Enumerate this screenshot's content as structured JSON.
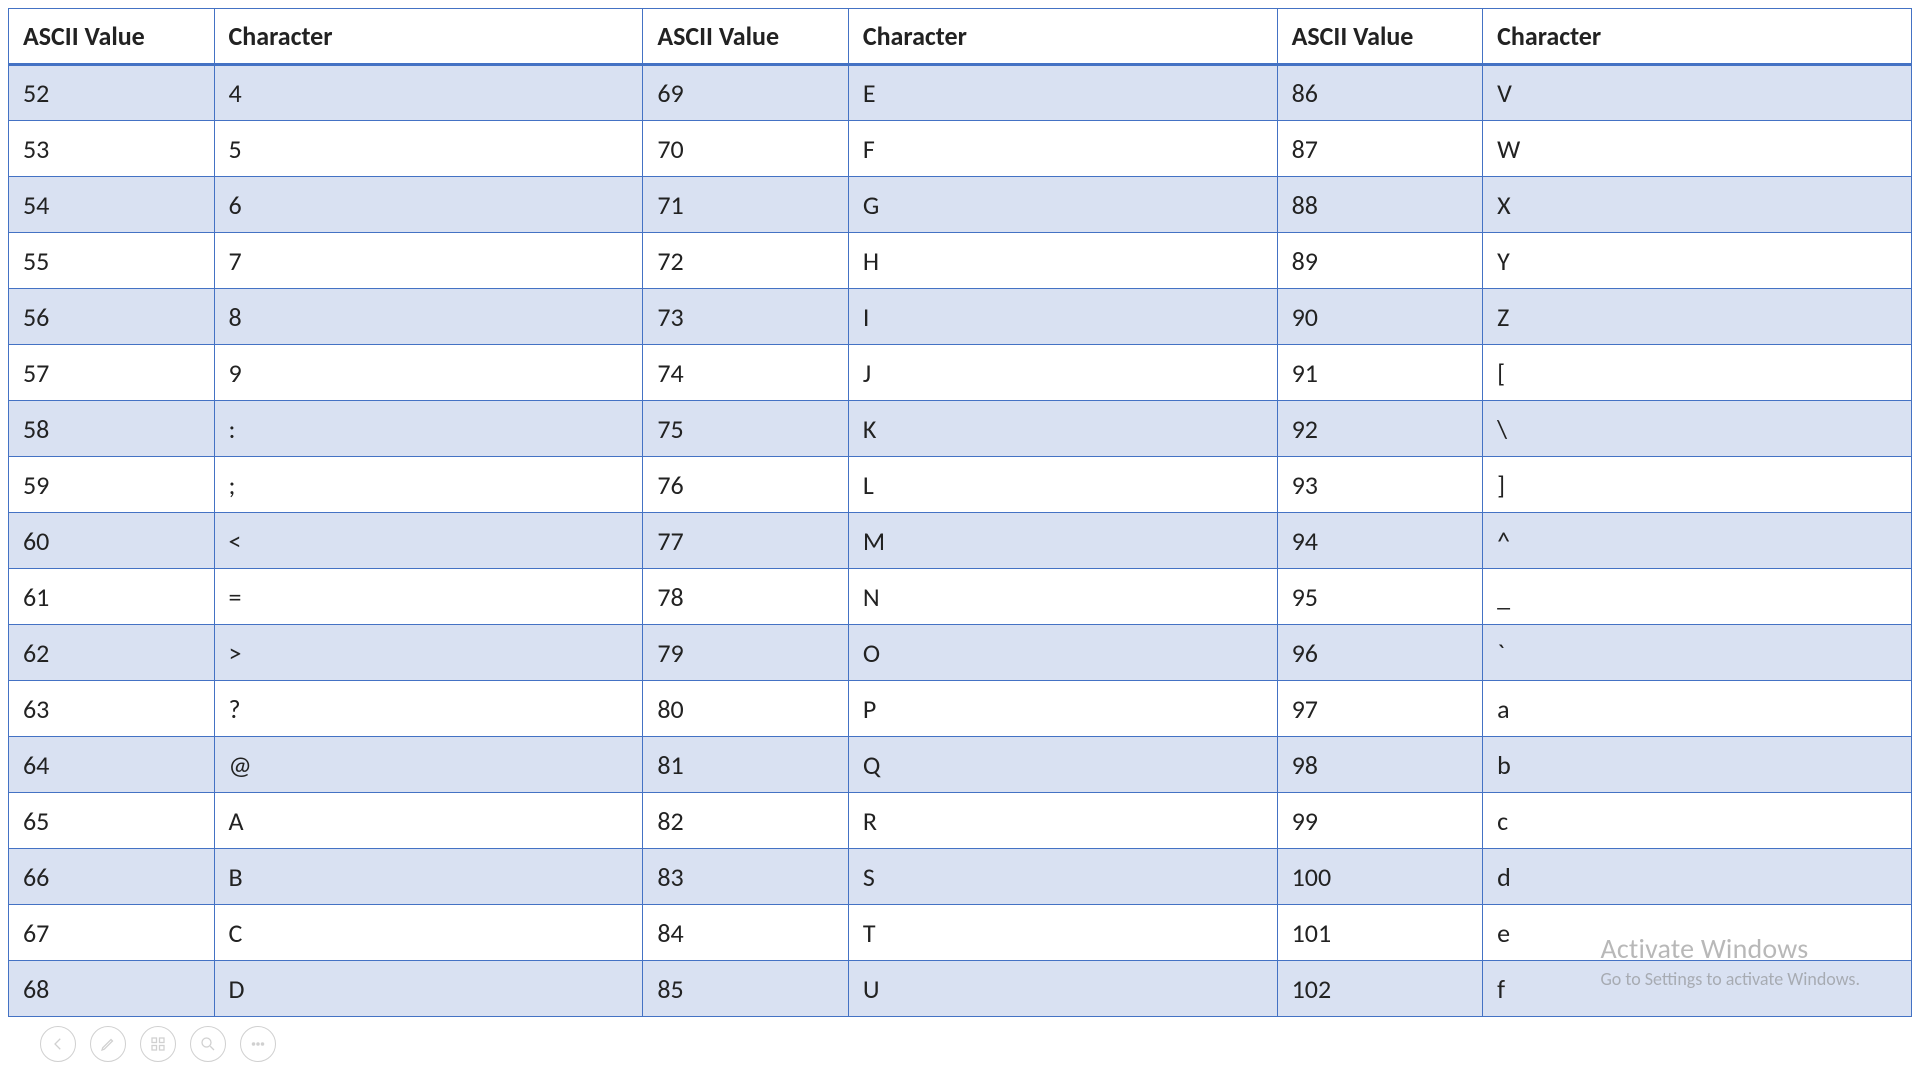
{
  "headers": [
    "ASCII Value",
    "Character",
    "ASCII Value",
    "Character",
    "ASCII Value",
    "Character"
  ],
  "rows": [
    [
      "52",
      "4",
      "69",
      "E",
      "86",
      "V"
    ],
    [
      "53",
      "5",
      "70",
      "F",
      "87",
      "W"
    ],
    [
      "54",
      "6",
      "71",
      "G",
      "88",
      "X"
    ],
    [
      "55",
      "7",
      "72",
      "H",
      "89",
      "Y"
    ],
    [
      "56",
      "8",
      "73",
      "I",
      "90",
      "Z"
    ],
    [
      "57",
      "9",
      "74",
      "J",
      "91",
      "["
    ],
    [
      "58",
      ":",
      "75",
      "K",
      "92",
      "\\"
    ],
    [
      "59",
      ";",
      "76",
      "L",
      "93",
      "]"
    ],
    [
      "60",
      "<",
      "77",
      "M",
      "94",
      "^"
    ],
    [
      "61",
      "=",
      "78",
      "N",
      "95",
      "_"
    ],
    [
      "62",
      ">",
      "79",
      "O",
      "96",
      "`"
    ],
    [
      "63",
      "?",
      "80",
      "P",
      "97",
      "a"
    ],
    [
      "64",
      "@",
      "81",
      "Q",
      "98",
      "b"
    ],
    [
      "65",
      "A",
      "82",
      "R",
      "99",
      "c"
    ],
    [
      "66",
      "B",
      "83",
      "S",
      "100",
      "d"
    ],
    [
      "67",
      "C",
      "84",
      "T",
      "101",
      "e"
    ],
    [
      "68",
      "D",
      "85",
      "U",
      "102",
      "f"
    ]
  ],
  "watermark": {
    "line1": "Activate Windows",
    "line2": "Go to Settings to activate Windows."
  }
}
